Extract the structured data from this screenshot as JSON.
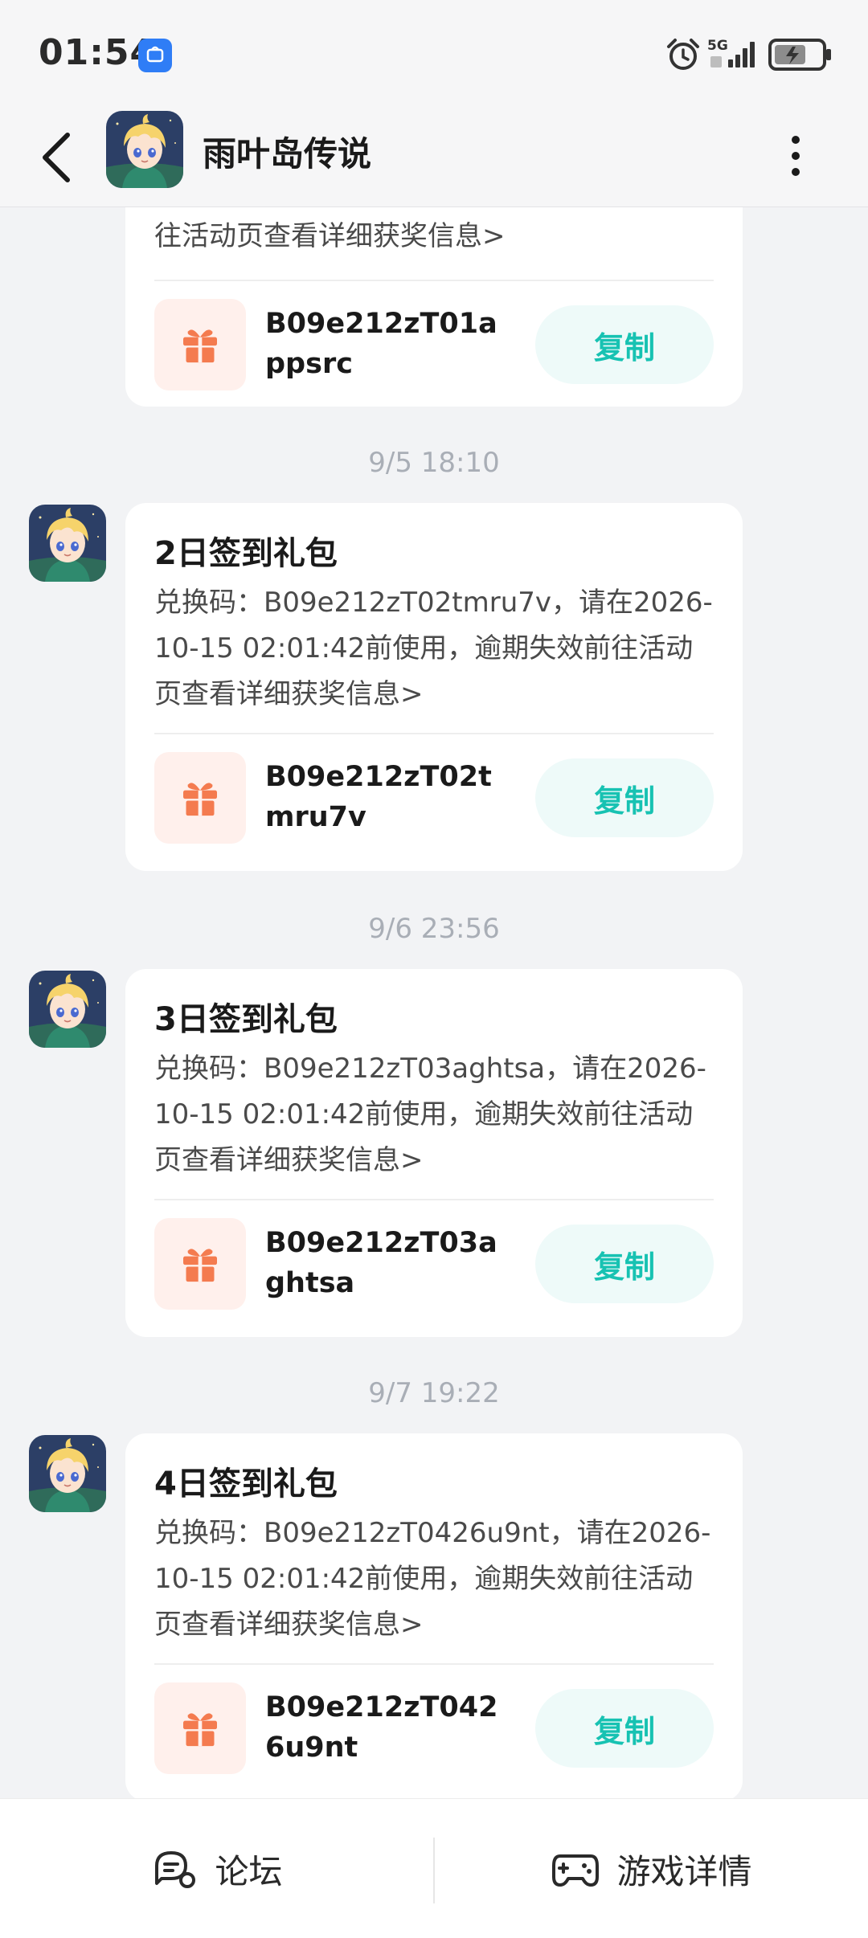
{
  "status_bar": {
    "time": "01:54",
    "app_icon_label": "App Market",
    "network": "5G"
  },
  "header": {
    "title": "雨叶岛传说"
  },
  "messages": [
    {
      "partial": true,
      "body_tail": "往活动页查看详细获奖信息>",
      "code": "B09e212zT01appsrc",
      "copy_label": "复制"
    },
    {
      "timestamp": "9/5  18:10",
      "title": "2日签到礼包",
      "body": "兑换码：B09e212zT02tmru7v，请在2026-10-15 02:01:42前使用，逾期失效前往活动页查看详细获奖信息>",
      "code": "B09e212zT02tmru7v",
      "copy_label": "复制"
    },
    {
      "timestamp": "9/6  23:56",
      "title": "3日签到礼包",
      "body": "兑换码：B09e212zT03aghtsa，请在2026-10-15 02:01:42前使用，逾期失效前往活动页查看详细获奖信息>",
      "code": "B09e212zT03aghtsa",
      "copy_label": "复制"
    },
    {
      "timestamp": "9/7  19:22",
      "title": "4日签到礼包",
      "body": "兑换码：B09e212zT0426u9nt，请在2026-10-15 02:01:42前使用，逾期失效前往活动页查看详细获奖信息>",
      "code": "B09e212zT0426u9nt",
      "copy_label": "复制"
    }
  ],
  "bottom_bar": {
    "forum_label": "论坛",
    "game_details_label": "游戏详情"
  },
  "colors": {
    "accent": "#17c2b2",
    "gift": "#f47b4f",
    "background": "#f2f3f5"
  }
}
